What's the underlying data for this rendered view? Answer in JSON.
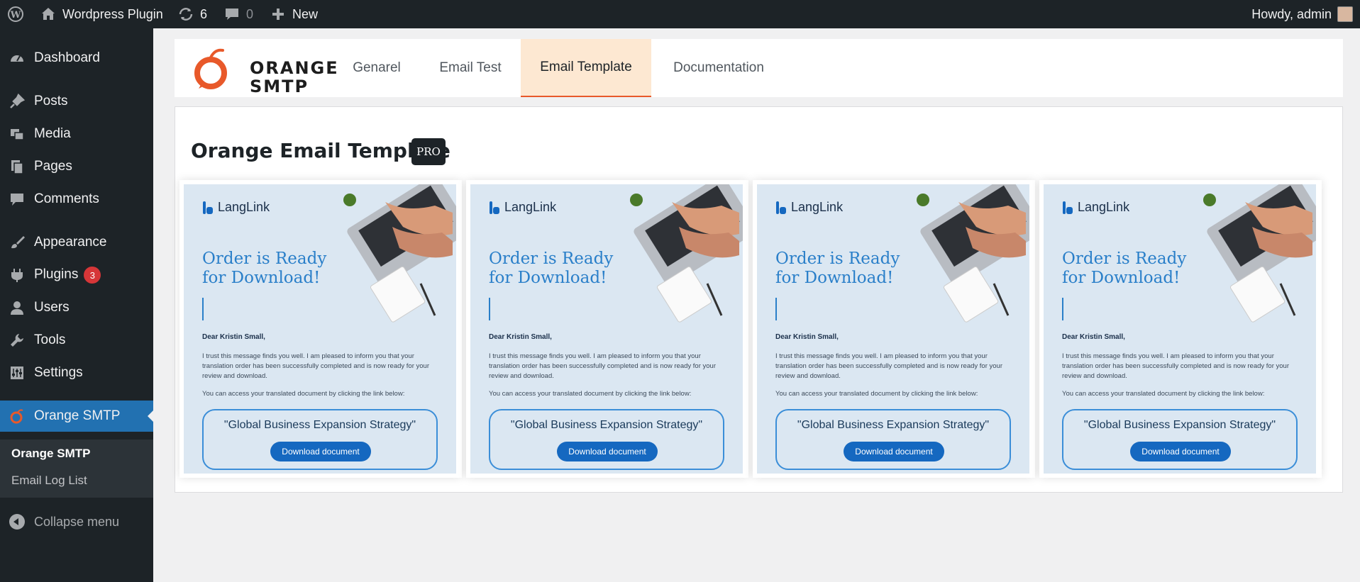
{
  "adminbar": {
    "site_name": "Wordpress Plugin",
    "updates_count": "6",
    "comments_count": "0",
    "new_label": "New",
    "howdy": "Howdy, admin"
  },
  "sidebar": {
    "items": [
      {
        "label": "Dashboard",
        "icon": "dashboard-icon"
      },
      {
        "label": "Posts",
        "icon": "pin-icon"
      },
      {
        "label": "Media",
        "icon": "media-icon"
      },
      {
        "label": "Pages",
        "icon": "pages-icon"
      },
      {
        "label": "Comments",
        "icon": "comment-icon"
      },
      {
        "label": "Appearance",
        "icon": "brush-icon"
      },
      {
        "label": "Plugins",
        "icon": "plugin-icon",
        "badge": "3"
      },
      {
        "label": "Users",
        "icon": "user-icon"
      },
      {
        "label": "Tools",
        "icon": "wrench-icon"
      },
      {
        "label": "Settings",
        "icon": "settings-icon"
      },
      {
        "label": "Orange SMTP",
        "icon": "orange-icon",
        "active": true
      }
    ],
    "submenu": [
      "Orange SMTP",
      "Email Log List"
    ],
    "collapse_label": "Collapse menu"
  },
  "plugin": {
    "logo_line1": "ORANGE",
    "logo_line2": "SMTP",
    "tabs": [
      "Genarel",
      "Email Test",
      "Email Template",
      "Documentation"
    ],
    "active_tab": "Email Template",
    "accent_color": "#e8592a"
  },
  "main": {
    "title": "Orange Email Template",
    "badge": "PRO"
  },
  "template": {
    "brand": "LangLink",
    "heading": "Order is Ready for Download!",
    "greeting": "Dear Kristin Small,",
    "body": "I trust this message finds you well. I am pleased to inform you that your translation order has been successfully completed and is now ready for your review and download.",
    "access": "You can access your translated document by clicking the link below:",
    "doc_title": "\"Global Business Expansion Strategy\"",
    "button": "Download document"
  }
}
